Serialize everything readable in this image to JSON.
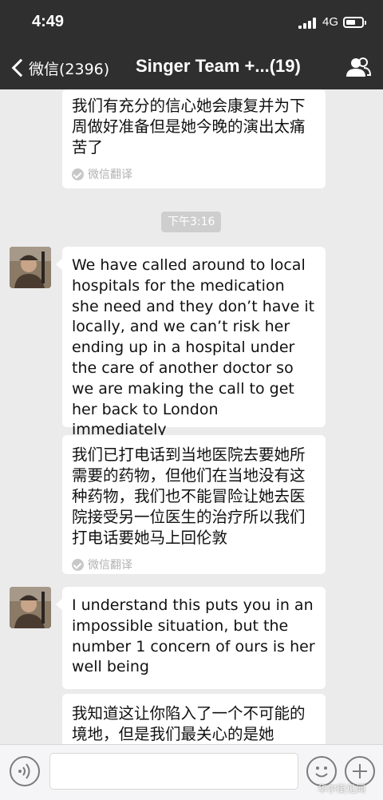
{
  "status_bar": {
    "time": "4:49",
    "network": "4G"
  },
  "nav": {
    "back_label": "微信(2396)",
    "title": "Singer Team +...(19)"
  },
  "messages": [
    {
      "type": "text",
      "lang": "zh",
      "text": "我们有充分的信心她会康复并为下周做好准备但是她今晚的演出太痛苦了",
      "translate_label": "微信翻译"
    },
    {
      "type": "time",
      "text": "下午3:16"
    },
    {
      "type": "text",
      "lang": "en",
      "text": "We have called around to local hospitals for the medication she need and they don’t have it locally, and we can’t risk her ending up in a hospital under the  care of another doctor so we are making the call to get her back to London immediately"
    },
    {
      "type": "text",
      "lang": "zh",
      "text": "我们已打电话到当地医院去要她所需要的药物，但他们在当地没有这种药物，我们也不能冒险让她去医院接受另一位医生的治疗所以我们打电话要她马上回伦敦",
      "translate_label": "微信翻译"
    },
    {
      "type": "text",
      "lang": "en",
      "text": "I understand this puts you in an impossible situation, but the number 1 concern of ours is her well being"
    },
    {
      "type": "text",
      "lang": "zh",
      "text": "我知道这让你陷入了一个不可能的境地，但是我们最关心的是她"
    }
  ],
  "watermark": "华尔街见闻",
  "colors": {
    "bar": "#2f2f2f",
    "chat_bg": "#ebebeb",
    "bubble": "#ffffff",
    "timestamp_bg": "#cecece"
  },
  "icons": {
    "back": "chevron-left-icon",
    "group": "group-members-icon",
    "voice": "voice-input-icon",
    "emoji": "emoji-icon",
    "more": "plus-icon",
    "translate": "check-circle-icon"
  }
}
